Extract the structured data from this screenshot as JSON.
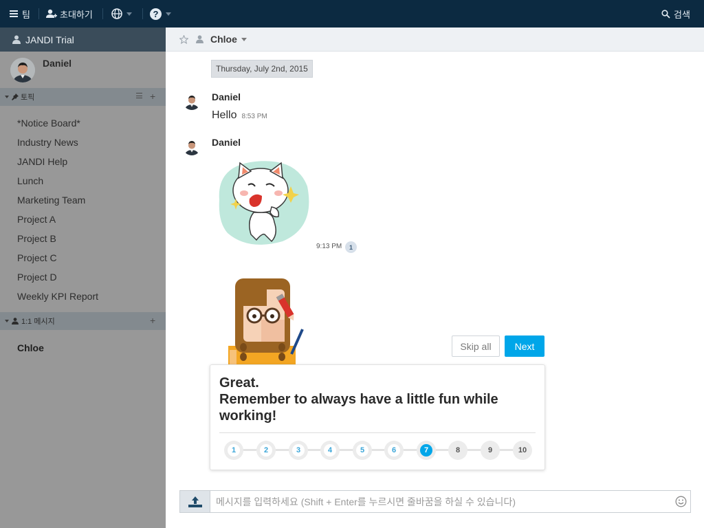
{
  "topbar": {
    "team_label": "팀",
    "invite_label": "초대하기",
    "search_label": "검색"
  },
  "sidebar": {
    "team_name": "JANDI Trial",
    "user_name": "Daniel",
    "topics_header": "토픽",
    "topics": [
      "*Notice Board*",
      "Industry News",
      "JANDI Help",
      "Lunch",
      "Marketing Team",
      "Project A",
      "Project B",
      "Project C",
      "Project D",
      "Weekly KPI Report"
    ],
    "dm_header": "1:1 메시지",
    "dm_items": [
      "Chloe"
    ]
  },
  "chat": {
    "title": "Chloe",
    "date": "Thursday, July 2nd, 2015",
    "messages": [
      {
        "author": "Daniel",
        "text": "Hello",
        "time": "8:53 PM"
      },
      {
        "author": "Daniel",
        "time": "9:13 PM",
        "unread": "1"
      }
    ],
    "input_placeholder": "메시지를 입력하세요 (Shift + Enter를 누르시면 줄바꿈을 하실 수 있습니다)"
  },
  "tour": {
    "skip_label": "Skip all",
    "next_label": "Next",
    "line1": "Great.",
    "line2": "Remember to always have a little fun while working!",
    "steps": [
      "1",
      "2",
      "3",
      "4",
      "5",
      "6",
      "7",
      "8",
      "9",
      "10"
    ],
    "current_step": "7"
  },
  "colors": {
    "topbar": "#0c2a41",
    "accent": "#00a6e9",
    "sidebar_overlay": "#989898"
  }
}
